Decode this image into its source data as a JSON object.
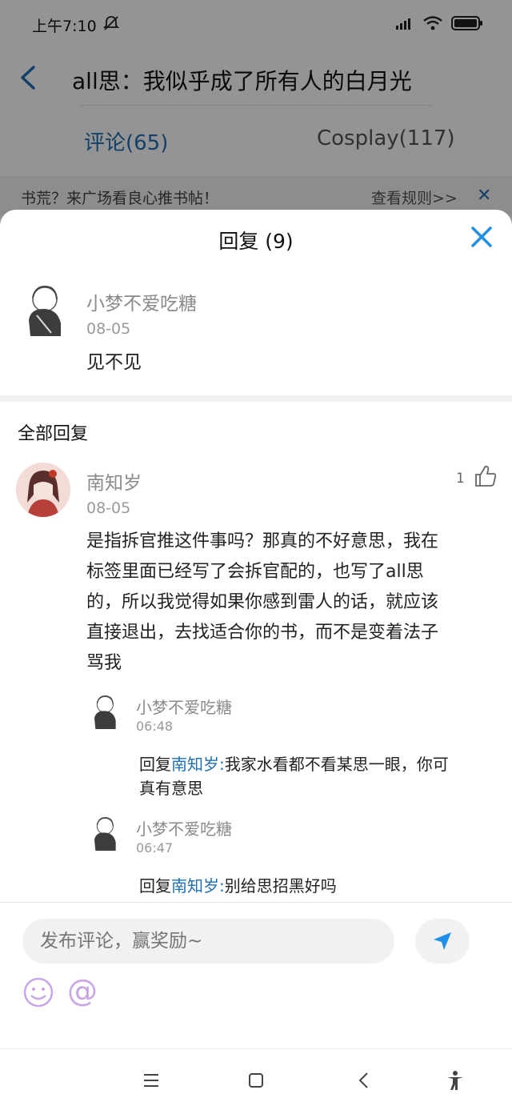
{
  "status_bar": {
    "time": "上午7:10",
    "battery_icon": "battery-icon",
    "wifi_icon": "wifi-icon",
    "signal_icon": "signal-icon"
  },
  "header": {
    "title": "all思：我似乎成了所有人的白月光"
  },
  "tabs": [
    {
      "label": "评论(65)"
    },
    {
      "label": "Cosplay(117)"
    }
  ],
  "banner": {
    "text": "书荒？来广场看良心推书帖！",
    "link": "查看规则>>",
    "close": "✕"
  },
  "sheet": {
    "title": "回复 (9)",
    "root_comment": {
      "username": "小梦不爱吃糖",
      "date": "08-05",
      "text": "见不见"
    },
    "section_title": "全部回复",
    "main_reply": {
      "username": "南知岁",
      "date": "08-05",
      "likes": "1",
      "text_lines": [
        "是指拆官推这件事吗？那真的不好意思，我在",
        "标签里面已经写了会拆官配的，也写了all思",
        "的，所以我觉得如果你感到雷人的话，就应该",
        "直接退出，去找适合你的书，而不是变着法子",
        "骂我"
      ]
    },
    "sub_replies": [
      {
        "username": "小梦不爱吃糖",
        "time": "06:48",
        "prefix": "回复",
        "mention": "南知岁",
        "colon": ":",
        "text": "我家水看都不看某思一眼，你可",
        "text2": "真有意思"
      },
      {
        "username": "小梦不爱吃糖",
        "time": "06:47",
        "prefix": "回复",
        "mention": "南知岁",
        "colon": ":",
        "text": "别给思招黑好吗",
        "text2": ""
      }
    ]
  },
  "input": {
    "placeholder": "发布评论，赢奖励~"
  },
  "colors": {
    "accent": "#1f6fb3",
    "mention": "#1f6fb3",
    "emoji": "#c9a6e8"
  }
}
